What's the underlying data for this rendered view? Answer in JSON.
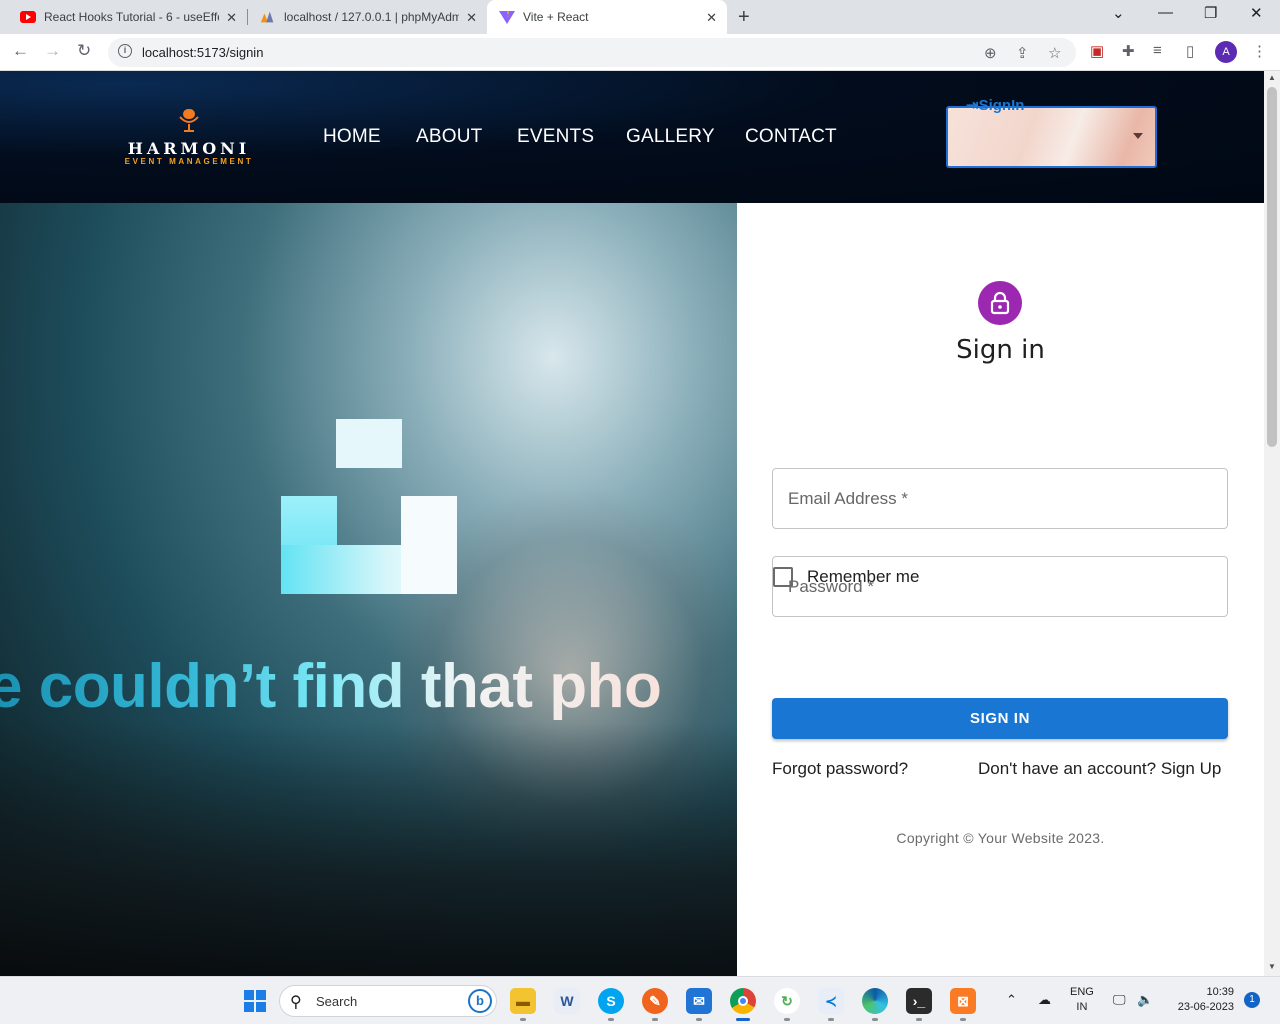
{
  "browser": {
    "tabs": [
      {
        "title": "React Hooks Tutorial - 6 - useEffe",
        "icon": "youtube-icon"
      },
      {
        "title": "localhost / 127.0.0.1 | phpMyAdm",
        "icon": "phpmyadmin-icon"
      },
      {
        "title": "Vite + React",
        "icon": "vite-icon",
        "active": true
      }
    ],
    "url": "localhost:5173/signin",
    "profile_initial": "A"
  },
  "header": {
    "logo": {
      "brand": "HARMONI",
      "tagline": "EVENT MANAGEMENT"
    },
    "nav": [
      "HOME",
      "ABOUT",
      "EVENTS",
      "GALLERY",
      "CONTACT"
    ],
    "signin_menu_label": "SignIn"
  },
  "hero": {
    "message": "e couldn’t find that pho"
  },
  "form": {
    "title": "Sign in",
    "email_placeholder": "Email Address *",
    "password_placeholder": "Password *",
    "remember_label": "Remember me",
    "submit_label": "SIGN IN",
    "forgot_link": "Forgot password?",
    "signup_link": "Don't have an account? Sign Up",
    "copyright": "Copyright © Your Website 2023."
  },
  "taskbar": {
    "search_placeholder": "Search",
    "language": [
      "ENG",
      "IN"
    ],
    "time": "10:39",
    "date": "23-06-2023",
    "notification_count": "1"
  },
  "colors": {
    "accent": "#1976d2",
    "avatar": "#9c27b0",
    "header_bg": "#020c1c"
  }
}
